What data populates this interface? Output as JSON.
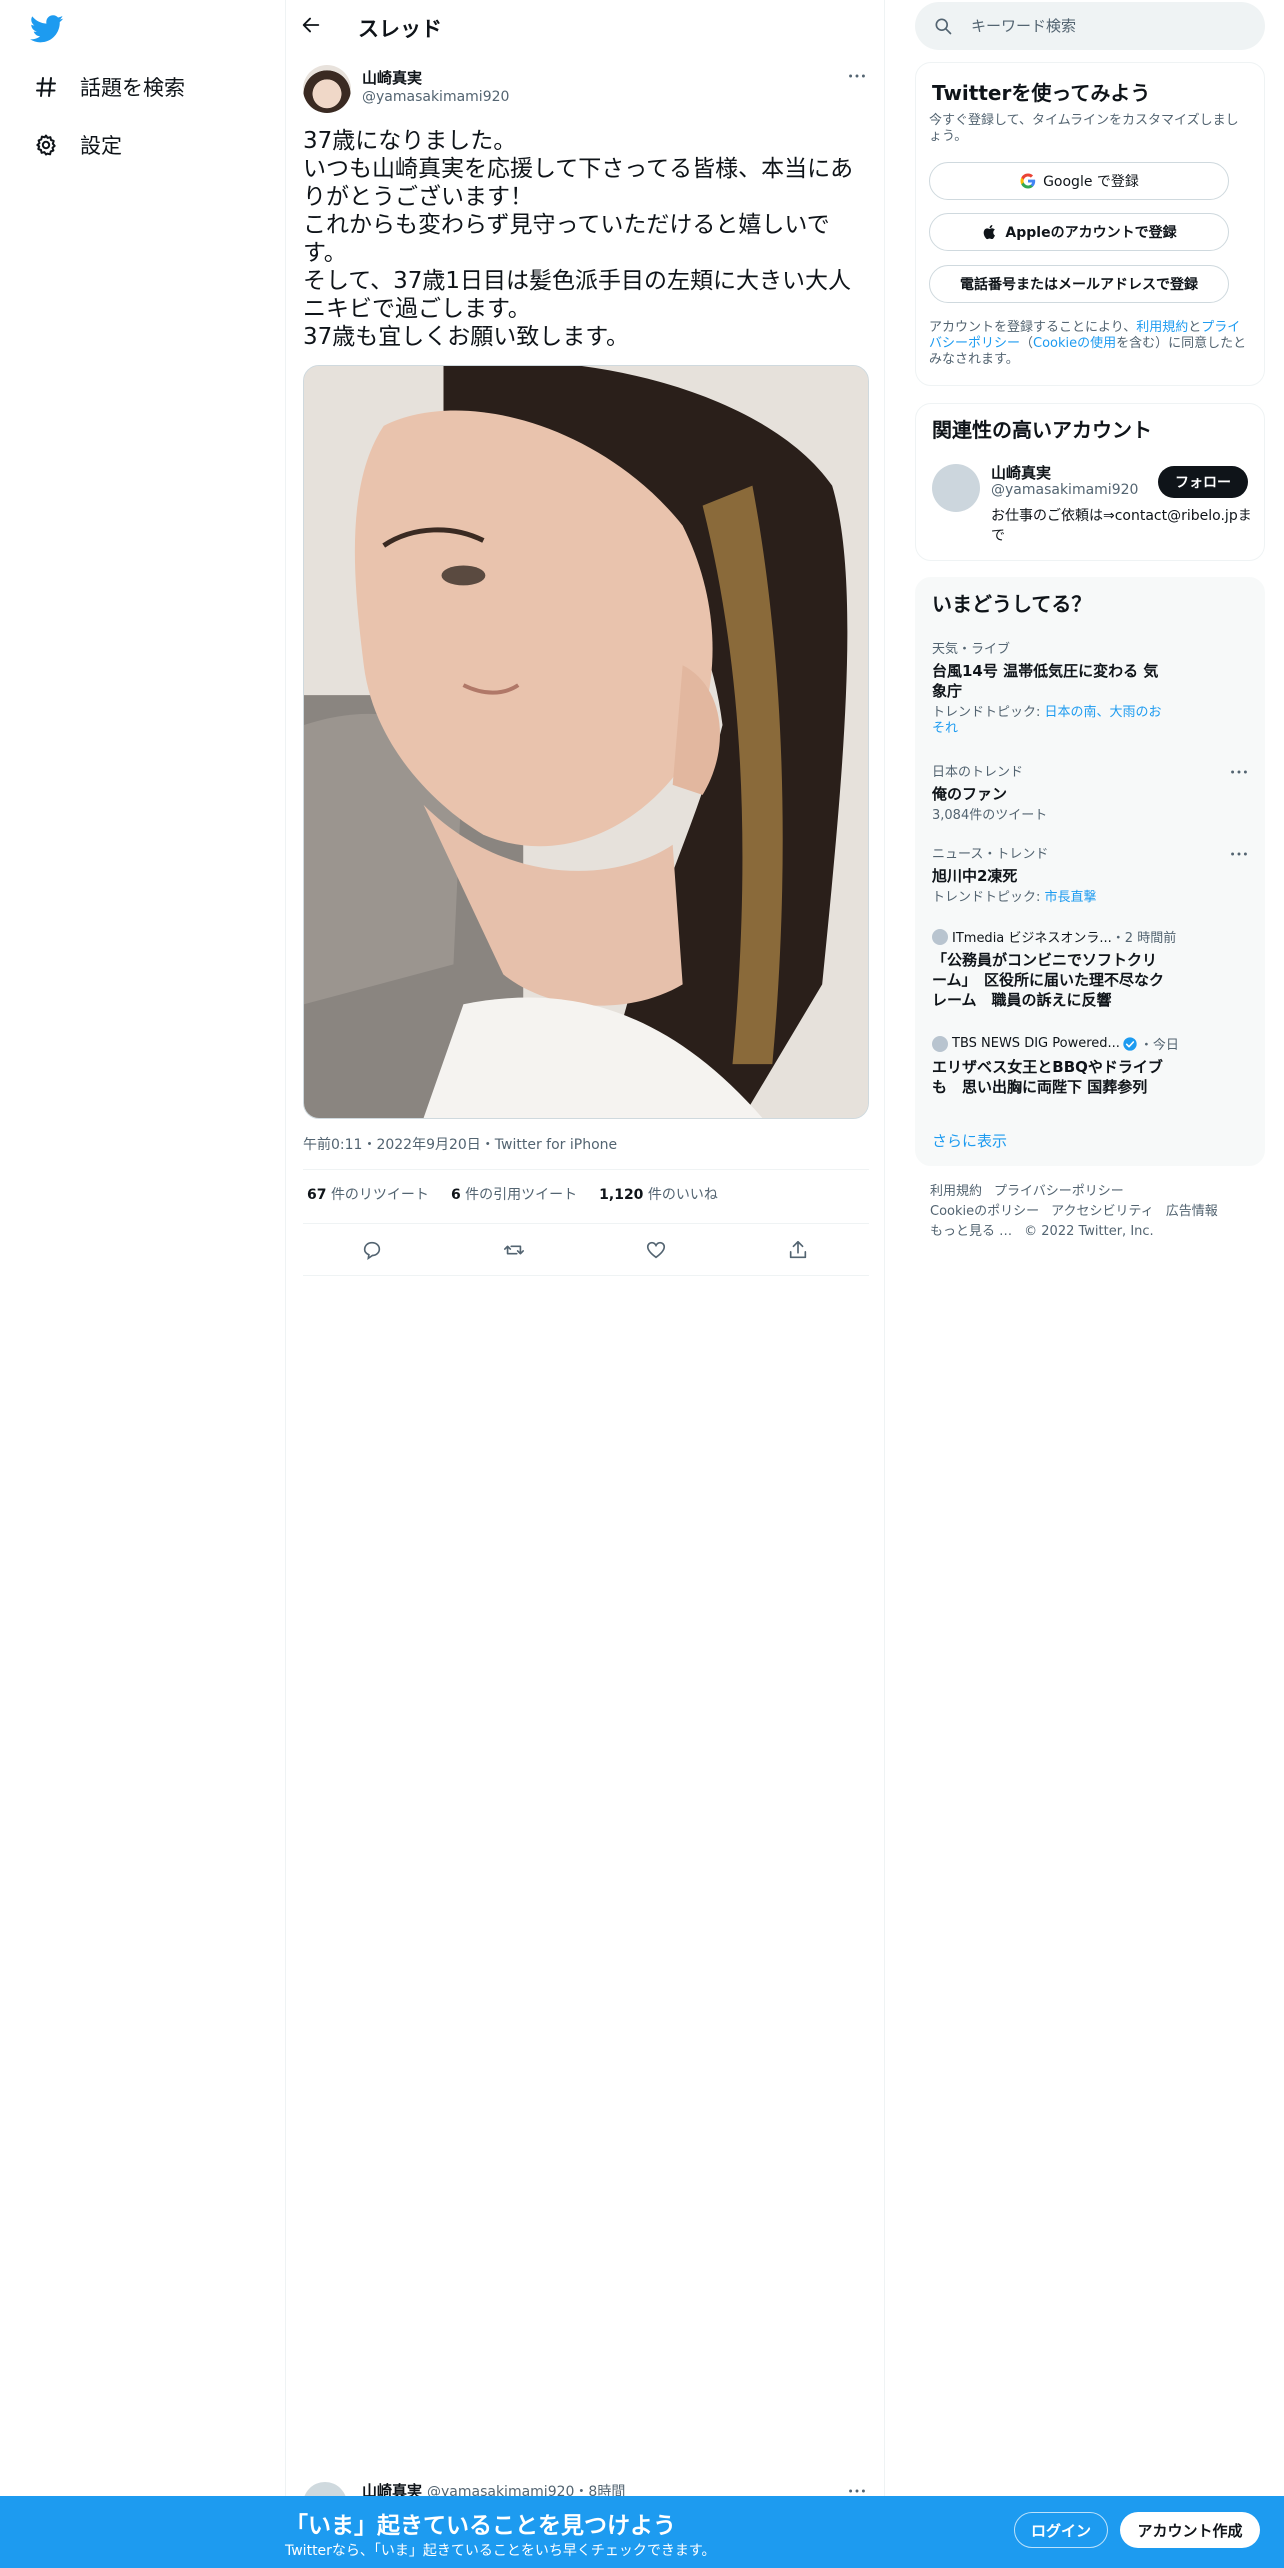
{
  "colors": {
    "brand": "#1d9bf0",
    "text": "#0f1419",
    "muted": "#536471",
    "banner": "#1d9bf0"
  },
  "nav": {
    "logo_icon": "twitter-bird-icon",
    "items": [
      {
        "label": "話題を検索",
        "icon": "hashtag-icon"
      },
      {
        "label": "設定",
        "icon": "gear-icon"
      }
    ]
  },
  "header": {
    "title": "スレッド",
    "back_icon": "back-arrow-icon"
  },
  "tweet": {
    "author_name": "山崎真実",
    "author_handle": "@yamasakimami920",
    "text_lines": [
      "37歳になりました。",
      "いつも山崎真実を応援して下さってる皆様、本当にありがとうございます！",
      "これからも変わらず見守っていただけると嬉しいです。",
      "そして、37歳1日目は髪色派手目の左頬に大きい大人ニキビで過ごします。",
      "37歳も宜しくお願い致します。"
    ],
    "timestamp": "午前0:11・2022年9月20日・Twitter for iPhone",
    "stats": {
      "retweets": {
        "count": "67",
        "label": "件のリツイート"
      },
      "quotes": {
        "count": "6",
        "label": "件の引用ツイート"
      },
      "likes": {
        "count": "1,120",
        "label": "件のいいね"
      }
    },
    "action_icons": [
      "reply-icon",
      "retweet-icon",
      "like-icon",
      "share-icon"
    ]
  },
  "reply_preview": {
    "name": "山崎真実",
    "handle": "@yamasakimami920・8時間"
  },
  "search": {
    "placeholder": "キーワード検索"
  },
  "signup_card": {
    "title": "Twitterを使ってみよう",
    "subtitle": "今すぐ登録して、タイムラインをカスタマイズしましょう。",
    "google": "Google で登録",
    "apple": "Appleのアカウントで登録",
    "phone": "電話番号またはメールアドレスで登録",
    "legal_pre": "アカウントを登録することにより、",
    "legal_terms": "利用規約",
    "legal_and": "と",
    "legal_privacy": "プライバシーポリシー",
    "legal_open": "（",
    "legal_cookie": "Cookieの使用",
    "legal_post": "を含む）に同意したとみなされます。"
  },
  "relevant_card": {
    "title": "関連性の高いアカウント",
    "name": "山崎真実",
    "handle": "@yamasakimami920",
    "follow": "フォロー",
    "bio": "お仕事のご依頼は⇒contact@ribelo.jpまで"
  },
  "trends_card": {
    "title": "いまどうしてる？",
    "items": [
      {
        "context": "天気・ライブ",
        "title": "台風14号 温帯低気圧に変わる 気象庁",
        "sub_pre": "トレンドトピック: ",
        "sub_link": "日本の南、大雨のおそれ"
      },
      {
        "context": "日本のトレンド",
        "title": "俺のファン",
        "sub_pre": "3,084件のツイート",
        "sub_link": ""
      },
      {
        "context": "ニュース・トレンド",
        "title": "旭川中2凍死",
        "sub_pre": "トレンドトピック: ",
        "sub_link": "市長直撃"
      }
    ],
    "news": [
      {
        "publisher": "ITmedia ビジネスオンラ...",
        "time": "・2 時間前",
        "title": "「公務員がコンビニでソフトクリーム」　区役所に届いた理不尽なクレーム　職員の訴えに反響"
      },
      {
        "publisher": "TBS NEWS DIG Powered...",
        "time": "・今日",
        "title": "エリザベス女王とBBQやドライブも　思い出胸に両陛下 国葬参列"
      }
    ],
    "show_more": "さらに表示"
  },
  "footer": {
    "line1": [
      "利用規約",
      "プライバシーポリシー"
    ],
    "line2": [
      "Cookieのポリシー",
      "アクセシビリティ",
      "広告情報"
    ],
    "line3": [
      "もっと見る …",
      "© 2022 Twitter, Inc."
    ]
  },
  "banner": {
    "title": "「いま」起きていることを見つけよう",
    "subtitle": "Twitterなら、「いま」起きていることをいち早くチェックできます。",
    "login": "ログイン",
    "signup": "アカウント作成"
  }
}
